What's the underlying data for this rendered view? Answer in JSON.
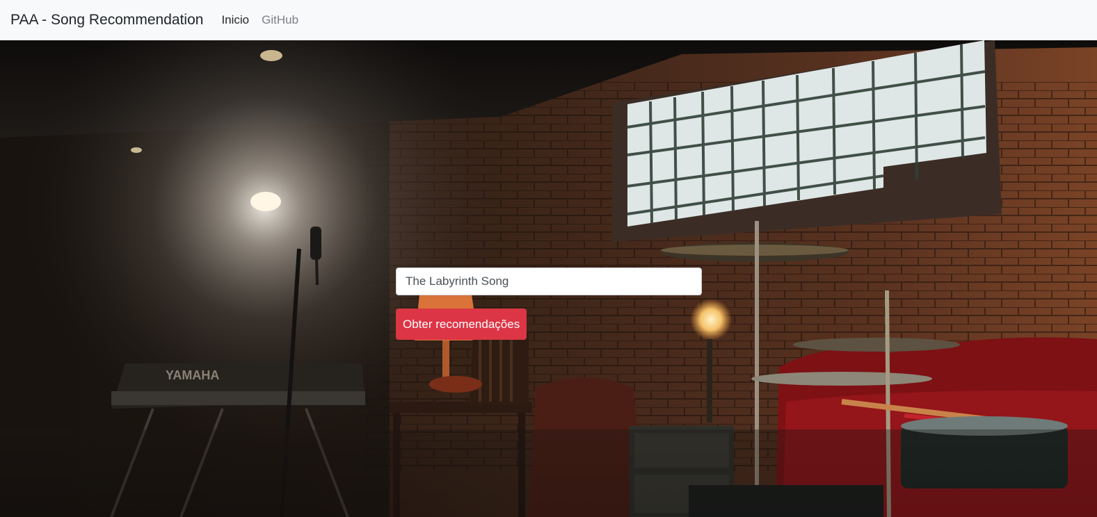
{
  "navbar": {
    "brand": "PAA - Song Recommendation",
    "links": [
      {
        "label": "Inicio",
        "active": true
      },
      {
        "label": "GitHub",
        "active": false
      }
    ]
  },
  "search": {
    "value": "The Labyrinth Song",
    "submit_label": "Obter recomendações"
  },
  "background": {
    "description_icon": "music-studio-photo",
    "keyboard_brand": "YAMAHA"
  },
  "colors": {
    "navbar_bg": "#f8f9fa",
    "button_bg": "#dc3545"
  }
}
